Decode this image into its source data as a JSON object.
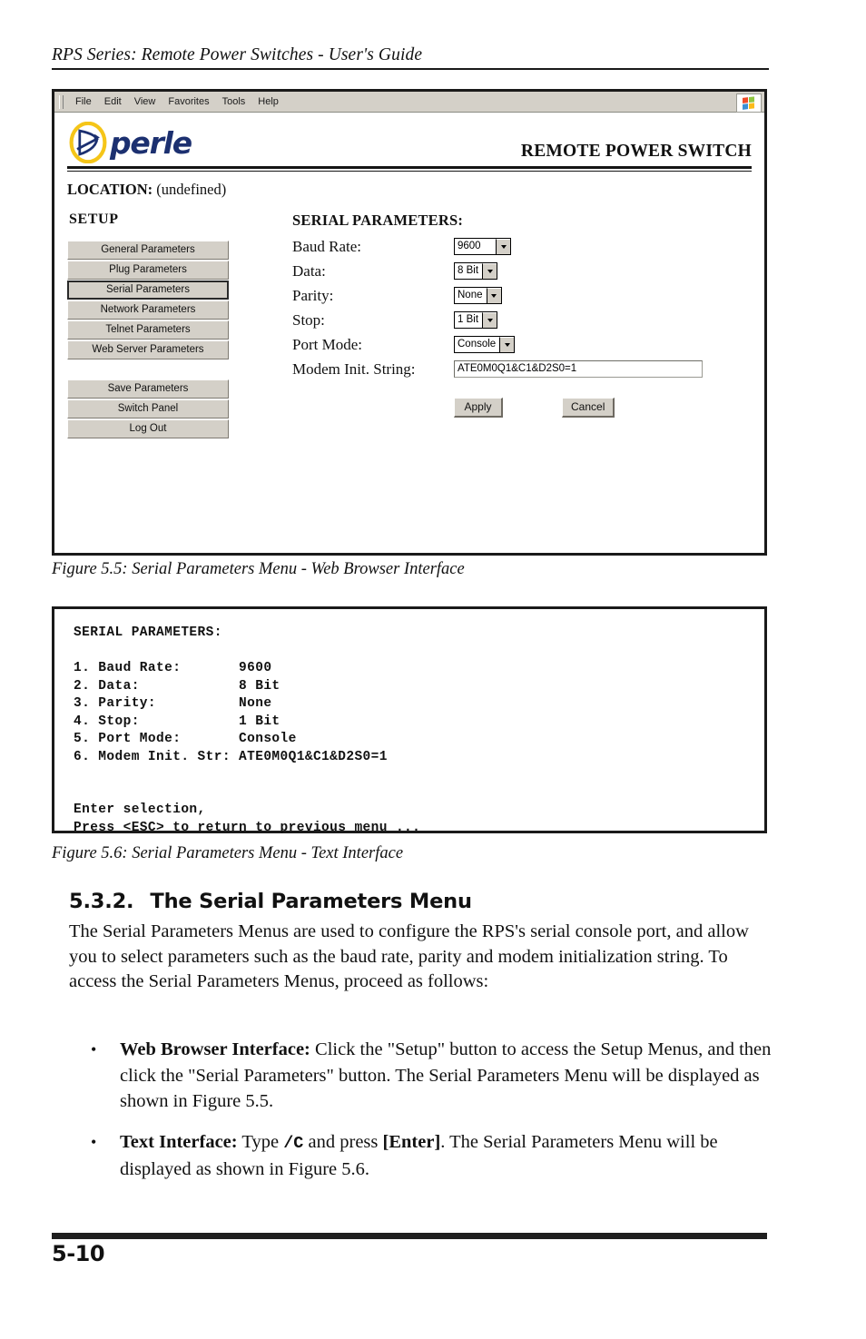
{
  "running_head": "RPS Series: Remote Power Switches - User's Guide",
  "figure_55": {
    "browser": {
      "menu_items": [
        "File",
        "Edit",
        "View",
        "Favorites",
        "Tools",
        "Help"
      ],
      "icon": "windows-flag-icon"
    },
    "brand": {
      "logo_word": "perle",
      "logo_mark": "perle-circle-arrow-logo",
      "title": "REMOTE POWER SWITCH"
    },
    "location": {
      "label": "LOCATION:",
      "value": "(undefined)"
    },
    "setup": {
      "heading": "SETUP",
      "primary_buttons": [
        {
          "label": "General Parameters",
          "selected": false
        },
        {
          "label": "Plug Parameters",
          "selected": false
        },
        {
          "label": "Serial Parameters",
          "selected": true
        },
        {
          "label": "Network Parameters",
          "selected": false
        },
        {
          "label": "Telnet Parameters",
          "selected": false
        },
        {
          "label": "Web Server Parameters",
          "selected": false
        }
      ],
      "secondary_buttons": [
        {
          "label": "Save Parameters"
        },
        {
          "label": "Switch Panel"
        },
        {
          "label": "Log Out"
        }
      ]
    },
    "form": {
      "heading": "SERIAL PARAMETERS:",
      "fields": [
        {
          "label": "Baud Rate:",
          "value": "9600",
          "type": "select"
        },
        {
          "label": "Data:",
          "value": "8 Bit",
          "type": "select"
        },
        {
          "label": "Parity:",
          "value": "None",
          "type": "select"
        },
        {
          "label": "Stop:",
          "value": "1 Bit",
          "type": "select"
        },
        {
          "label": "Port Mode:",
          "value": "Console",
          "type": "select"
        },
        {
          "label": "Modem Init. String:",
          "value": "ATE0M0Q1&C1&D2S0=1",
          "type": "text"
        }
      ],
      "apply_label": "Apply",
      "cancel_label": "Cancel"
    },
    "caption": "Figure 5.5:  Serial Parameters Menu - Web Browser Interface"
  },
  "figure_56": {
    "terminal_lines": [
      "SERIAL PARAMETERS:",
      "",
      "1. Baud Rate:       9600",
      "2. Data:            8 Bit",
      "3. Parity:          None",
      "4. Stop:            1 Bit",
      "5. Port Mode:       Console",
      "6. Modem Init. Str: ATE0M0Q1&C1&D2S0=1",
      "",
      "",
      "Enter selection,",
      "Press <ESC> to return to previous menu ..."
    ],
    "caption": "Figure 5.6:  Serial Parameters Menu - Text Interface"
  },
  "section": {
    "number": "5.3.2.",
    "title": "The Serial Parameters Menu",
    "paragraph": "The Serial Parameters Menus are used to configure the RPS's serial console port, and allow you to select parameters such as the baud rate, parity and modem initialization string.  To access the Serial Parameters Menus, proceed as follows:",
    "bullets": [
      {
        "marker": "•",
        "lead": "Web Browser Interface:",
        "rest": "  Click the \"Setup\" button to access the Setup Menus, and then click the \"Serial Parameters\" button.  The Serial Parameters Menu will be displayed as shown in Figure 5.5."
      },
      {
        "marker": "•",
        "lead": "Text Interface:",
        "mid_a": "  Type ",
        "code": "/C",
        "mid_b": " and press ",
        "bold_key": "[Enter]",
        "rest": ".  The Serial Parameters Menu will be displayed as shown in Figure 5.6."
      }
    ]
  },
  "footer": {
    "page_number": "5-10"
  },
  "colors": {
    "brand_blue": "#1c3070",
    "brand_gold": "#f5c518",
    "chrome_gray": "#d4d0c8",
    "ink": "#111111"
  }
}
